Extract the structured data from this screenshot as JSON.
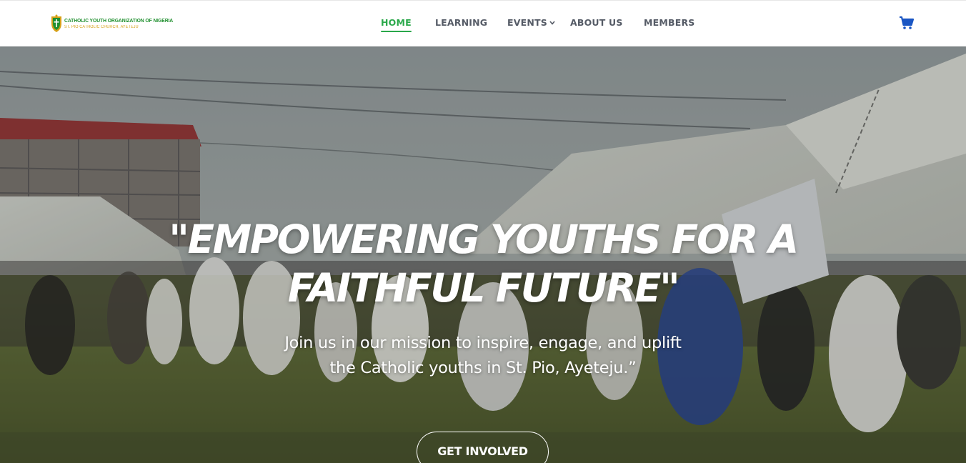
{
  "brand": {
    "title": "CATHOLIC YOUTH ORGANIZATION OF NIGERIA",
    "subtitle": "ST. PIO CATHOLIC CHURCH, AYETEJU",
    "logo_icon": "crest-icon",
    "colors": {
      "green": "#1f8f2e",
      "gold": "#d4a017"
    }
  },
  "nav": {
    "items": [
      {
        "label": "HOME",
        "active": true
      },
      {
        "label": "LEARNING",
        "active": false
      },
      {
        "label": "EVENTS",
        "active": false,
        "has_dropdown": true
      },
      {
        "label": "ABOUT US",
        "active": false
      },
      {
        "label": "MEMBERS",
        "active": false
      }
    ],
    "active_color": "#2aa84a",
    "cart_icon": "shopping-cart-icon",
    "cart_color": "#1a56c4"
  },
  "hero": {
    "headline_line1": "\"EMPOWERING YOUTHS FOR A",
    "headline_line2": "FAITHFUL FUTURE\"",
    "subtext_line1": "Join us in our mission to inspire, engage, and uplift",
    "subtext_line2": "the Catholic youths in St. Pio, Ayeteju.”",
    "cta_label": "GET INVOLVED"
  }
}
